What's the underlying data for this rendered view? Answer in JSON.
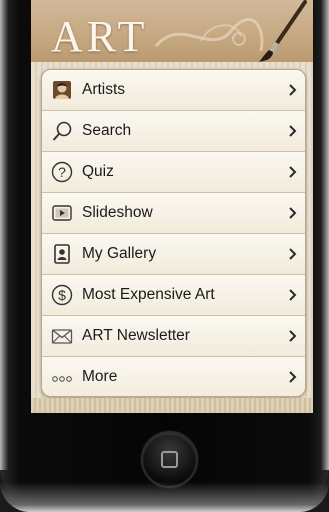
{
  "app": {
    "title": "ART"
  },
  "menu": {
    "items": [
      {
        "label": "Artists",
        "icon": "artist-portrait-icon"
      },
      {
        "label": "Search",
        "icon": "magnifier-icon"
      },
      {
        "label": "Quiz",
        "icon": "question-mark-icon"
      },
      {
        "label": "Slideshow",
        "icon": "slideshow-play-icon"
      },
      {
        "label": "My Gallery",
        "icon": "picture-frame-icon"
      },
      {
        "label": "Most Expensive Art",
        "icon": "dollar-icon"
      },
      {
        "label": "ART Newsletter",
        "icon": "envelope-icon"
      },
      {
        "label": "More",
        "icon": "more-dots-icon"
      }
    ]
  },
  "colors": {
    "header": "#c7a983",
    "menu_background": "#f5f0e4",
    "chevron": "#2a2a2a"
  }
}
